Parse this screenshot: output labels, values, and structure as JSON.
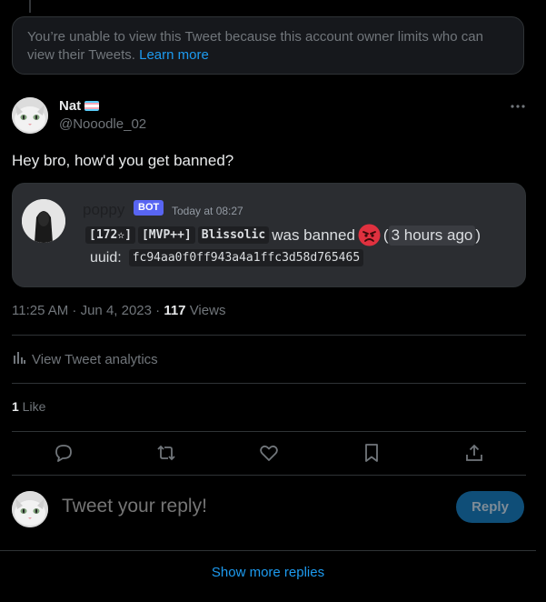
{
  "restricted": {
    "message": "You’re unable to view this Tweet because this account owner limits who can view their Tweets.",
    "link": "Learn more"
  },
  "tweet": {
    "author_name": "Nat",
    "handle": "@Nooodle_02",
    "text": "Hey bro, how'd you get banned?",
    "time": "11:25 AM · Jun 4, 2023 · ",
    "views_count": "117",
    "views_label": " Views",
    "analytics_label": "View Tweet analytics",
    "likes_count": "1",
    "likes_label": " Like"
  },
  "embed": {
    "username": "poppy",
    "bot_tag": "BOT",
    "timestamp": "Today at 08:27",
    "rank": "[172✫]",
    "tier": "[MVP++]",
    "player": "Blissolic",
    "banned_text": "was banned",
    "ago_open": "(",
    "ago": "3 hours ago",
    "ago_close": ")",
    "uuid_label": "uuid:",
    "uuid": "fc94aa0f0ff943a4a1ffc3d58d765465"
  },
  "reply": {
    "placeholder": "Tweet your reply!",
    "button": "Reply"
  },
  "footer": {
    "show_more": "Show more replies"
  },
  "colors": {
    "background": "#000000",
    "accent": "#1d9bf0",
    "discord_bot": "#5865f2",
    "embed_bg": "#2b2d31"
  },
  "icons": [
    "more-icon",
    "reply-icon",
    "retweet-icon",
    "like-icon",
    "bookmark-icon",
    "share-icon",
    "analytics-icon",
    "angry-emoji-icon",
    "trans-flag-icon"
  ]
}
